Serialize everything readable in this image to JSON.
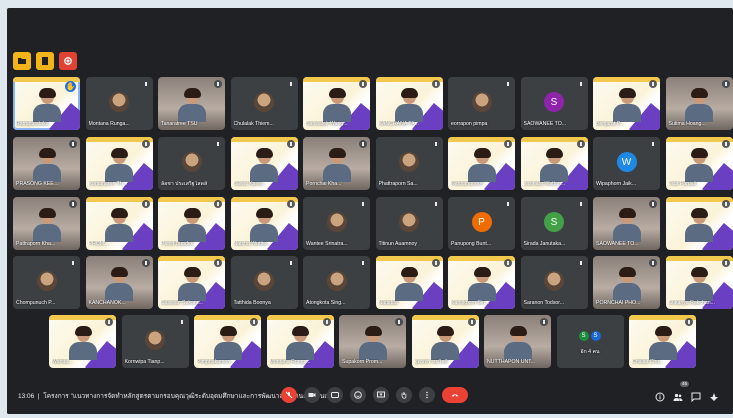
{
  "meeting": {
    "time": "13:06",
    "title": "โครงการ \"แนวทางการจัดทำหลักสูตรตามกรอบคุณวุฒิระดับอุดมศึกษาและการพัฒนาสมรรถนะผู้เรียนเพื่อ...\"",
    "more_count_label": "อีก 4 คน",
    "participant_badge": "46"
  },
  "toolbar_icons": [
    "folder-icon",
    "folder-icon",
    "record-icon"
  ],
  "controls": [
    "mic-off-icon",
    "camera-icon",
    "captions-icon",
    "emoji-icon",
    "present-icon",
    "raise-hand-icon",
    "more-options-icon",
    "end-call-icon"
  ],
  "right_icons": [
    "info-icon",
    "people-icon",
    "chat-icon",
    "activities-icon"
  ],
  "colors": {
    "background": "#202124",
    "tile": "#3c4043",
    "accent": "#8ab4f8",
    "danger": "#ea4335",
    "slide_purple": "#6b3fc2",
    "slide_yellow": "#f3c94d"
  },
  "rows": [
    [
      {
        "name": "Ratrabarstaka",
        "type": "slide",
        "active": true,
        "hand": true
      },
      {
        "name": "Montana Runga...",
        "type": "avatar_img"
      },
      {
        "name": "Tanaratree TSU",
        "type": "photo"
      },
      {
        "name": "Chulalak Thiem...",
        "type": "avatar_img"
      },
      {
        "name": "Saowalak Wang...",
        "type": "slide"
      },
      {
        "name": "KANCHANA TA...",
        "type": "slide"
      },
      {
        "name": "eorrapon pimpa",
        "type": "avatar_img"
      },
      {
        "name": "SAOWANEE TO...",
        "type": "letter",
        "letter": "S",
        "color": "#8e24aa"
      },
      {
        "name": "Benjarat P...",
        "type": "slide"
      },
      {
        "name": "Sutima Hoang...",
        "type": "photo"
      }
    ],
    [
      {
        "name": "PRASONG KEE...",
        "type": "photo"
      },
      {
        "name": "Kantanaree Th...",
        "type": "slide"
      },
      {
        "name": "ล้อชา ประเสริฐโสดส์",
        "type": "avatar_img"
      },
      {
        "name": "Sawai Kaew...",
        "type": "slide"
      },
      {
        "name": "Pornchai Kha...",
        "type": "photo"
      },
      {
        "name": "Phattraporn Sa...",
        "type": "avatar_img"
      },
      {
        "name": "Natthananoon",
        "type": "slide"
      },
      {
        "name": "sasinara Wattan...",
        "type": "slide"
      },
      {
        "name": "Wipaphorn Jaik...",
        "type": "letter",
        "letter": "W",
        "color": "#1e88e5"
      },
      {
        "name": "Tida Paruati",
        "type": "slide"
      }
    ],
    [
      {
        "name": "Pattraporn Kha...",
        "type": "photo"
      },
      {
        "name": "PHOM...",
        "type": "slide"
      },
      {
        "name": "Panid Buadee",
        "type": "slide"
      },
      {
        "name": "Natcha Wuttiw...",
        "type": "slide"
      },
      {
        "name": "Wantee Srinatra...",
        "type": "avatar_img"
      },
      {
        "name": "Titinun Auamnoy",
        "type": "avatar_img"
      },
      {
        "name": "Panupong Bunt...",
        "type": "letter",
        "letter": "P",
        "color": "#ef6c00"
      },
      {
        "name": "Sirada Janutaka...",
        "type": "letter",
        "letter": "S",
        "color": "#43a047"
      },
      {
        "name": "SAOWANEE TO...",
        "type": "photo"
      },
      {
        "name": "",
        "type": "slide"
      }
    ],
    [
      {
        "name": "Chompunuch P...",
        "type": "avatar_img"
      },
      {
        "name": "KANCHANOK...",
        "type": "photo"
      },
      {
        "name": "Sasiwan Sukara...",
        "type": "slide"
      },
      {
        "name": "Tatthida Boonya",
        "type": "avatar_img"
      },
      {
        "name": "Atongkota Sing...",
        "type": "avatar_img"
      },
      {
        "name": "Nattidaa",
        "type": "slide"
      },
      {
        "name": "Kanokporn Sin...",
        "type": "slide"
      },
      {
        "name": "Saranon Todsor...",
        "type": "avatar_img"
      },
      {
        "name": "PORNCHAI PHO...",
        "type": "photo"
      },
      {
        "name": "Sukanya Rakchan...",
        "type": "slide"
      }
    ],
    [
      {
        "name": "Wanita...",
        "type": "slide"
      },
      {
        "name": "Kornwipa Tianp...",
        "type": "avatar_img"
      },
      {
        "name": "Pimphakamon...",
        "type": "slide"
      },
      {
        "name": "Montana Rungs...",
        "type": "slide"
      },
      {
        "name": "Supakorn Prom...",
        "type": "photo"
      },
      {
        "name": "อุดมพร สมใจดี",
        "type": "slide"
      },
      {
        "name": "NUTTHAPON UNT...",
        "type": "photo"
      },
      {
        "name": "อีก 4 คน",
        "type": "more"
      },
      {
        "name": "Chalita Chu...",
        "type": "slide"
      }
    ]
  ]
}
